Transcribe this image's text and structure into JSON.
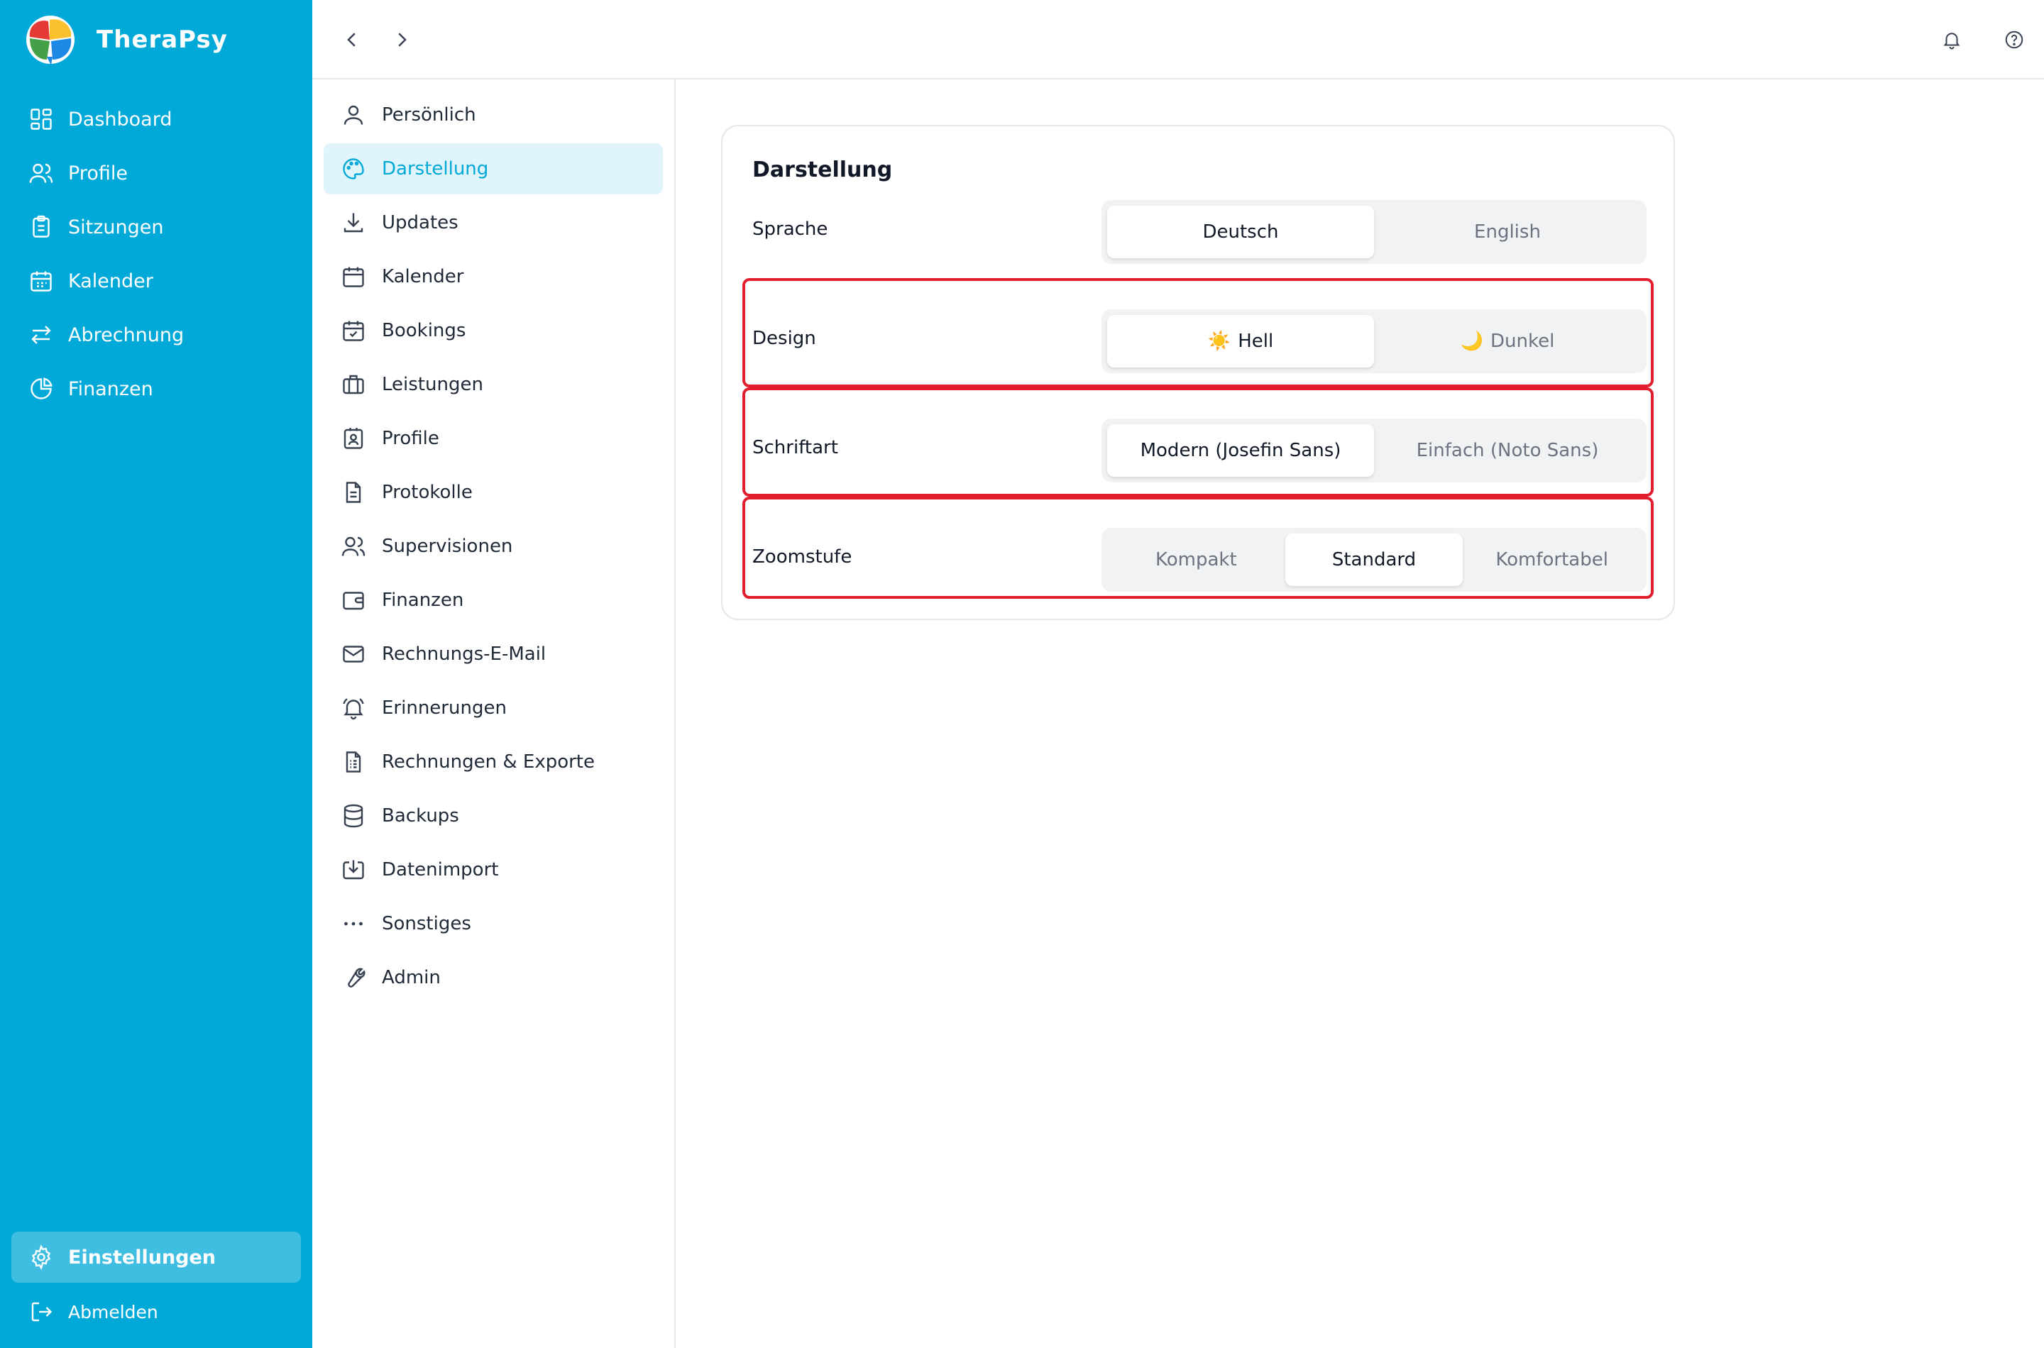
{
  "app": {
    "name": "TheraPsy"
  },
  "sidebar": {
    "items": [
      {
        "label": "Dashboard",
        "icon": "dashboard-icon"
      },
      {
        "label": "Profile",
        "icon": "users-icon"
      },
      {
        "label": "Sitzungen",
        "icon": "clipboard-icon"
      },
      {
        "label": "Kalender",
        "icon": "calendar-icon"
      },
      {
        "label": "Abrechnung",
        "icon": "arrows-icon"
      },
      {
        "label": "Finanzen",
        "icon": "pie-chart-icon"
      }
    ],
    "settings_label": "Einstellungen",
    "logout_label": "Abmelden"
  },
  "settings_nav": [
    {
      "label": "Persönlich"
    },
    {
      "label": "Darstellung"
    },
    {
      "label": "Updates"
    },
    {
      "label": "Kalender"
    },
    {
      "label": "Bookings"
    },
    {
      "label": "Leistungen"
    },
    {
      "label": "Profile"
    },
    {
      "label": "Protokolle"
    },
    {
      "label": "Supervisionen"
    },
    {
      "label": "Finanzen"
    },
    {
      "label": "Rechnungs-E-Mail"
    },
    {
      "label": "Erinnerungen"
    },
    {
      "label": "Rechnungen & Exporte"
    },
    {
      "label": "Backups"
    },
    {
      "label": "Datenimport"
    },
    {
      "label": "Sonstiges"
    },
    {
      "label": "Admin"
    }
  ],
  "active_settings_item": "Darstellung",
  "appearance": {
    "title": "Darstellung",
    "language": {
      "label": "Sprache",
      "options": [
        "Deutsch",
        "English"
      ],
      "selected": "Deutsch"
    },
    "design": {
      "label": "Design",
      "options": [
        {
          "emoji": "☀️",
          "text": "Hell"
        },
        {
          "emoji": "🌙",
          "text": "Dunkel"
        }
      ],
      "selected": "Hell"
    },
    "font": {
      "label": "Schriftart",
      "options": [
        "Modern (Josefin Sans)",
        "Einfach (Noto Sans)"
      ],
      "selected": "Modern (Josefin Sans)"
    },
    "zoom": {
      "label": "Zoomstufe",
      "options": [
        "Kompakt",
        "Standard",
        "Komfortabel"
      ],
      "selected": "Standard"
    }
  },
  "colors": {
    "brand": "#00a9d8",
    "highlight": "#e11d2e"
  }
}
